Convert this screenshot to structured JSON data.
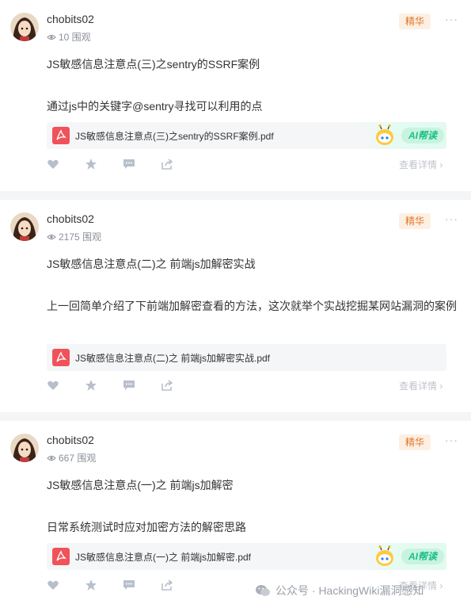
{
  "posts": [
    {
      "username": "chobits02",
      "views": "10 围观",
      "badge": "精华",
      "more": "···",
      "title": "JS敏感信息注意点(三)之sentry的SSRF案例",
      "desc": "通过js中的关键字@sentry寻找可以利用的点",
      "attachment": "JS敏感信息注意点(三)之sentry的SSRF案例.pdf",
      "ai_label": "AI帮读",
      "detail": "查看详情"
    },
    {
      "username": "chobits02",
      "views": "2175 围观",
      "badge": "精华",
      "more": "···",
      "title": "JS敏感信息注意点(二)之 前端js加解密实战",
      "desc": "上一回简单介绍了下前端加解密查看的方法，这次就举个实战挖掘某网站漏洞的案例",
      "attachment": "JS敏感信息注意点(二)之 前端js加解密实战.pdf",
      "detail": "查看详情"
    },
    {
      "username": "chobits02",
      "views": "667 围观",
      "badge": "精华",
      "more": "···",
      "title": "JS敏感信息注意点(一)之 前端js加解密",
      "desc": "日常系统测试时应对加密方法的解密思路",
      "attachment": "JS敏感信息注意点(一)之 前端js加解密.pdf",
      "ai_label": "AI帮读",
      "detail": "查看详情"
    }
  ],
  "watermark": "公众号 · HackingWiki漏洞感知",
  "colors": {
    "badge_text": "#e0762a",
    "badge_bg": "#fdf0e3",
    "ai_text": "#1bbf87",
    "pdf_red": "#f0525a"
  }
}
